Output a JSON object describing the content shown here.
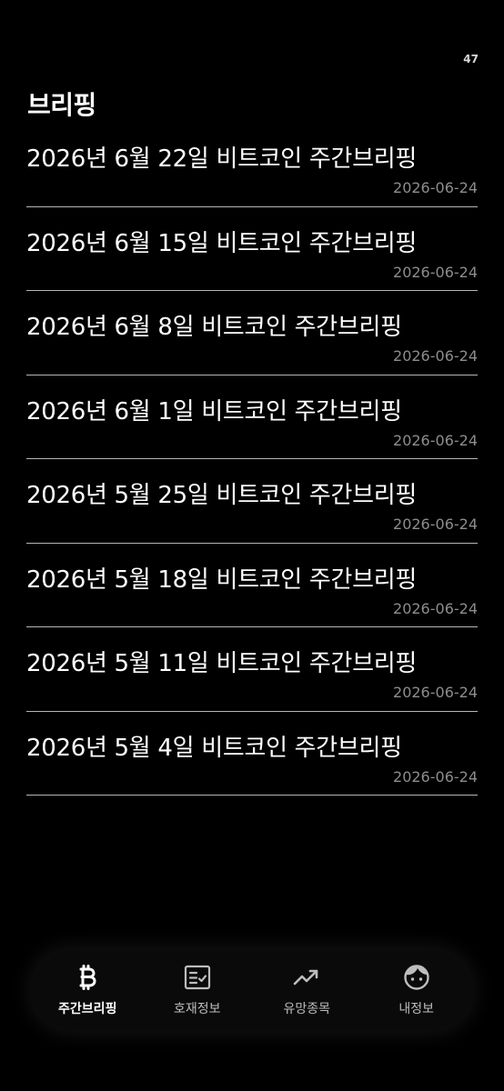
{
  "status": {
    "number": "47"
  },
  "header": {
    "title": "브리핑"
  },
  "items": [
    {
      "title": "2026년 6월 22일 비트코인 주간브리핑",
      "date": "2026-06-24"
    },
    {
      "title": "2026년 6월 15일 비트코인 주간브리핑",
      "date": "2026-06-24"
    },
    {
      "title": "2026년 6월 8일 비트코인 주간브리핑",
      "date": "2026-06-24"
    },
    {
      "title": "2026년 6월 1일 비트코인 주간브리핑",
      "date": "2026-06-24"
    },
    {
      "title": "2026년 5월 25일 비트코인 주간브리핑",
      "date": "2026-06-24"
    },
    {
      "title": "2026년 5월 18일 비트코인 주간브리핑",
      "date": "2026-06-24"
    },
    {
      "title": "2026년 5월 11일 비트코인 주간브리핑",
      "date": "2026-06-24"
    },
    {
      "title": "2026년 5월 4일 비트코인 주간브리핑",
      "date": "2026-06-24"
    }
  ],
  "nav": {
    "items": [
      {
        "label": "주간브리핑",
        "icon": "bitcoin-icon",
        "active": true
      },
      {
        "label": "호재정보",
        "icon": "checklist-icon",
        "active": false
      },
      {
        "label": "유망종목",
        "icon": "trending-up-icon",
        "active": false
      },
      {
        "label": "내정보",
        "icon": "face-icon",
        "active": false
      }
    ]
  },
  "colors": {
    "background": "#000000",
    "text": "#ffffff",
    "date": "#8d8d8d",
    "divider": "#b5b5b5",
    "nav_background": "#0a0a0a"
  }
}
